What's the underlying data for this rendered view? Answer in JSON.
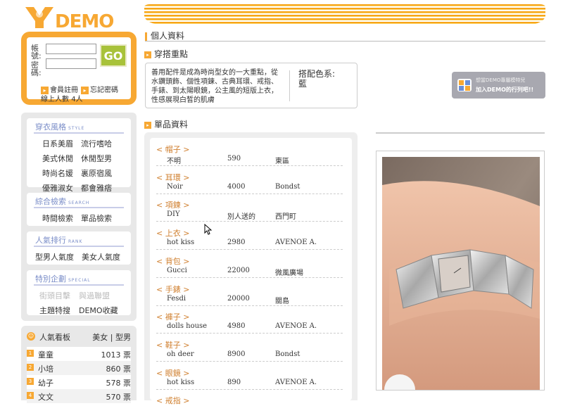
{
  "logo": {
    "text": "DEMO"
  },
  "login": {
    "account_label": "帳號:",
    "password_label": "密碼:",
    "go_label": "GO",
    "register_label": "會員註冊",
    "forgot_label": "忘記密碼",
    "online_label": "線上人數",
    "online_count": "4人"
  },
  "menus": [
    {
      "title": "穿衣風格",
      "sub": "STYLE",
      "items": [
        {
          "label": "日系美眉",
          "faded": false
        },
        {
          "label": "流行嗜哈",
          "faded": false
        },
        {
          "label": "美式休閒",
          "faded": false
        },
        {
          "label": "休閒型男",
          "faded": false
        },
        {
          "label": "時尚名媛",
          "faded": false
        },
        {
          "label": "裏原宿風",
          "faded": false
        },
        {
          "label": "優雅淑女",
          "faded": false
        },
        {
          "label": "都會雅痞",
          "faded": false
        }
      ]
    },
    {
      "title": "綜合檢索",
      "sub": "SEARCH",
      "items": [
        {
          "label": "時間檢索",
          "faded": false
        },
        {
          "label": "單品檢索",
          "faded": false
        }
      ]
    },
    {
      "title": "人氣排行",
      "sub": "RANK",
      "items": [
        {
          "label": "型男人氣度",
          "faded": false
        },
        {
          "label": "美女人氣度",
          "faded": false
        }
      ]
    },
    {
      "title": "特別企劃",
      "sub": "SPECIAL",
      "items": [
        {
          "label": "街頭目擊",
          "faded": true
        },
        {
          "label": "與過聯盟",
          "faded": true
        },
        {
          "label": "主題特搜",
          "faded": false
        },
        {
          "label": "DEMO收藏",
          "faded": false
        }
      ]
    }
  ],
  "board": {
    "title": "人氣看板",
    "filter": "美女 | 型男",
    "rows": [
      {
        "rank": "1",
        "name": "童童",
        "count": "1013 票"
      },
      {
        "rank": "2",
        "name": "小培",
        "count": "860 票"
      },
      {
        "rank": "3",
        "name": "幼子",
        "count": "578 票"
      },
      {
        "rank": "4",
        "name": "文文",
        "count": "570 票"
      }
    ]
  },
  "profile_title": "個人資料",
  "emphasis": {
    "title": "穿搭重點",
    "text": "善用配件是成為時尚型女的一大重點，從水鑽頭飾、個性項鍊、古典耳環、戒指、手錶、到太陽眼鏡，公主風的短版上衣，性感展現白皙的肌膚",
    "color_label": "搭配色系:",
    "color_value": "藍"
  },
  "items": {
    "title": "單品資料",
    "rows": [
      {
        "category": "< 帽子 >",
        "name": "不明",
        "price": "590",
        "store": "東區"
      },
      {
        "category": "< 耳環 >",
        "name": "Noir",
        "price": "4000",
        "store": "Bondst"
      },
      {
        "category": "< 項鍊 >",
        "name": "DIY",
        "price": "別人送的",
        "store": "西門町"
      },
      {
        "category": "< 上衣 >",
        "name": "hot kiss",
        "price": "2980",
        "store": "AVENOE A."
      },
      {
        "category": "< 背包 >",
        "name": "Gucci",
        "price": "22000",
        "store": "微風廣場"
      },
      {
        "category": "< 手錶 >",
        "name": "Fesdi",
        "price": "20000",
        "store": "關島"
      },
      {
        "category": "< 褲子 >",
        "name": "dolls house",
        "price": "4980",
        "store": "AVENOE A."
      },
      {
        "category": "< 鞋子 >",
        "name": "oh deer",
        "price": "8900",
        "store": "Bondst"
      },
      {
        "category": "< 眼鏡 >",
        "name": "hot kiss",
        "price": "890",
        "store": "AVENOE A."
      },
      {
        "category": "< 戒指 >",
        "name": "",
        "price": "",
        "store": ""
      }
    ]
  },
  "ad": {
    "line1": "想當DEMO專屬模特兒",
    "line2": "加入DEMO的行列吧!!"
  },
  "colors": {
    "accent": "#f7a833",
    "menu_title": "#7a8dc8",
    "category": "#d08030",
    "go": "#a8c23a"
  }
}
